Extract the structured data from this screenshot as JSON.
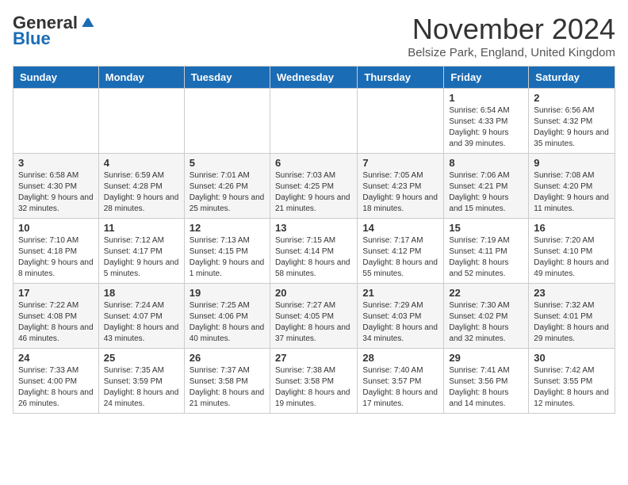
{
  "logo": {
    "general": "General",
    "blue": "Blue"
  },
  "title": "November 2024",
  "location": "Belsize Park, England, United Kingdom",
  "days_of_week": [
    "Sunday",
    "Monday",
    "Tuesday",
    "Wednesday",
    "Thursday",
    "Friday",
    "Saturday"
  ],
  "weeks": [
    [
      {
        "day": "",
        "info": ""
      },
      {
        "day": "",
        "info": ""
      },
      {
        "day": "",
        "info": ""
      },
      {
        "day": "",
        "info": ""
      },
      {
        "day": "",
        "info": ""
      },
      {
        "day": "1",
        "info": "Sunrise: 6:54 AM\nSunset: 4:33 PM\nDaylight: 9 hours and 39 minutes."
      },
      {
        "day": "2",
        "info": "Sunrise: 6:56 AM\nSunset: 4:32 PM\nDaylight: 9 hours and 35 minutes."
      }
    ],
    [
      {
        "day": "3",
        "info": "Sunrise: 6:58 AM\nSunset: 4:30 PM\nDaylight: 9 hours and 32 minutes."
      },
      {
        "day": "4",
        "info": "Sunrise: 6:59 AM\nSunset: 4:28 PM\nDaylight: 9 hours and 28 minutes."
      },
      {
        "day": "5",
        "info": "Sunrise: 7:01 AM\nSunset: 4:26 PM\nDaylight: 9 hours and 25 minutes."
      },
      {
        "day": "6",
        "info": "Sunrise: 7:03 AM\nSunset: 4:25 PM\nDaylight: 9 hours and 21 minutes."
      },
      {
        "day": "7",
        "info": "Sunrise: 7:05 AM\nSunset: 4:23 PM\nDaylight: 9 hours and 18 minutes."
      },
      {
        "day": "8",
        "info": "Sunrise: 7:06 AM\nSunset: 4:21 PM\nDaylight: 9 hours and 15 minutes."
      },
      {
        "day": "9",
        "info": "Sunrise: 7:08 AM\nSunset: 4:20 PM\nDaylight: 9 hours and 11 minutes."
      }
    ],
    [
      {
        "day": "10",
        "info": "Sunrise: 7:10 AM\nSunset: 4:18 PM\nDaylight: 9 hours and 8 minutes."
      },
      {
        "day": "11",
        "info": "Sunrise: 7:12 AM\nSunset: 4:17 PM\nDaylight: 9 hours and 5 minutes."
      },
      {
        "day": "12",
        "info": "Sunrise: 7:13 AM\nSunset: 4:15 PM\nDaylight: 9 hours and 1 minute."
      },
      {
        "day": "13",
        "info": "Sunrise: 7:15 AM\nSunset: 4:14 PM\nDaylight: 8 hours and 58 minutes."
      },
      {
        "day": "14",
        "info": "Sunrise: 7:17 AM\nSunset: 4:12 PM\nDaylight: 8 hours and 55 minutes."
      },
      {
        "day": "15",
        "info": "Sunrise: 7:19 AM\nSunset: 4:11 PM\nDaylight: 8 hours and 52 minutes."
      },
      {
        "day": "16",
        "info": "Sunrise: 7:20 AM\nSunset: 4:10 PM\nDaylight: 8 hours and 49 minutes."
      }
    ],
    [
      {
        "day": "17",
        "info": "Sunrise: 7:22 AM\nSunset: 4:08 PM\nDaylight: 8 hours and 46 minutes."
      },
      {
        "day": "18",
        "info": "Sunrise: 7:24 AM\nSunset: 4:07 PM\nDaylight: 8 hours and 43 minutes."
      },
      {
        "day": "19",
        "info": "Sunrise: 7:25 AM\nSunset: 4:06 PM\nDaylight: 8 hours and 40 minutes."
      },
      {
        "day": "20",
        "info": "Sunrise: 7:27 AM\nSunset: 4:05 PM\nDaylight: 8 hours and 37 minutes."
      },
      {
        "day": "21",
        "info": "Sunrise: 7:29 AM\nSunset: 4:03 PM\nDaylight: 8 hours and 34 minutes."
      },
      {
        "day": "22",
        "info": "Sunrise: 7:30 AM\nSunset: 4:02 PM\nDaylight: 8 hours and 32 minutes."
      },
      {
        "day": "23",
        "info": "Sunrise: 7:32 AM\nSunset: 4:01 PM\nDaylight: 8 hours and 29 minutes."
      }
    ],
    [
      {
        "day": "24",
        "info": "Sunrise: 7:33 AM\nSunset: 4:00 PM\nDaylight: 8 hours and 26 minutes."
      },
      {
        "day": "25",
        "info": "Sunrise: 7:35 AM\nSunset: 3:59 PM\nDaylight: 8 hours and 24 minutes."
      },
      {
        "day": "26",
        "info": "Sunrise: 7:37 AM\nSunset: 3:58 PM\nDaylight: 8 hours and 21 minutes."
      },
      {
        "day": "27",
        "info": "Sunrise: 7:38 AM\nSunset: 3:58 PM\nDaylight: 8 hours and 19 minutes."
      },
      {
        "day": "28",
        "info": "Sunrise: 7:40 AM\nSunset: 3:57 PM\nDaylight: 8 hours and 17 minutes."
      },
      {
        "day": "29",
        "info": "Sunrise: 7:41 AM\nSunset: 3:56 PM\nDaylight: 8 hours and 14 minutes."
      },
      {
        "day": "30",
        "info": "Sunrise: 7:42 AM\nSunset: 3:55 PM\nDaylight: 8 hours and 12 minutes."
      }
    ]
  ]
}
